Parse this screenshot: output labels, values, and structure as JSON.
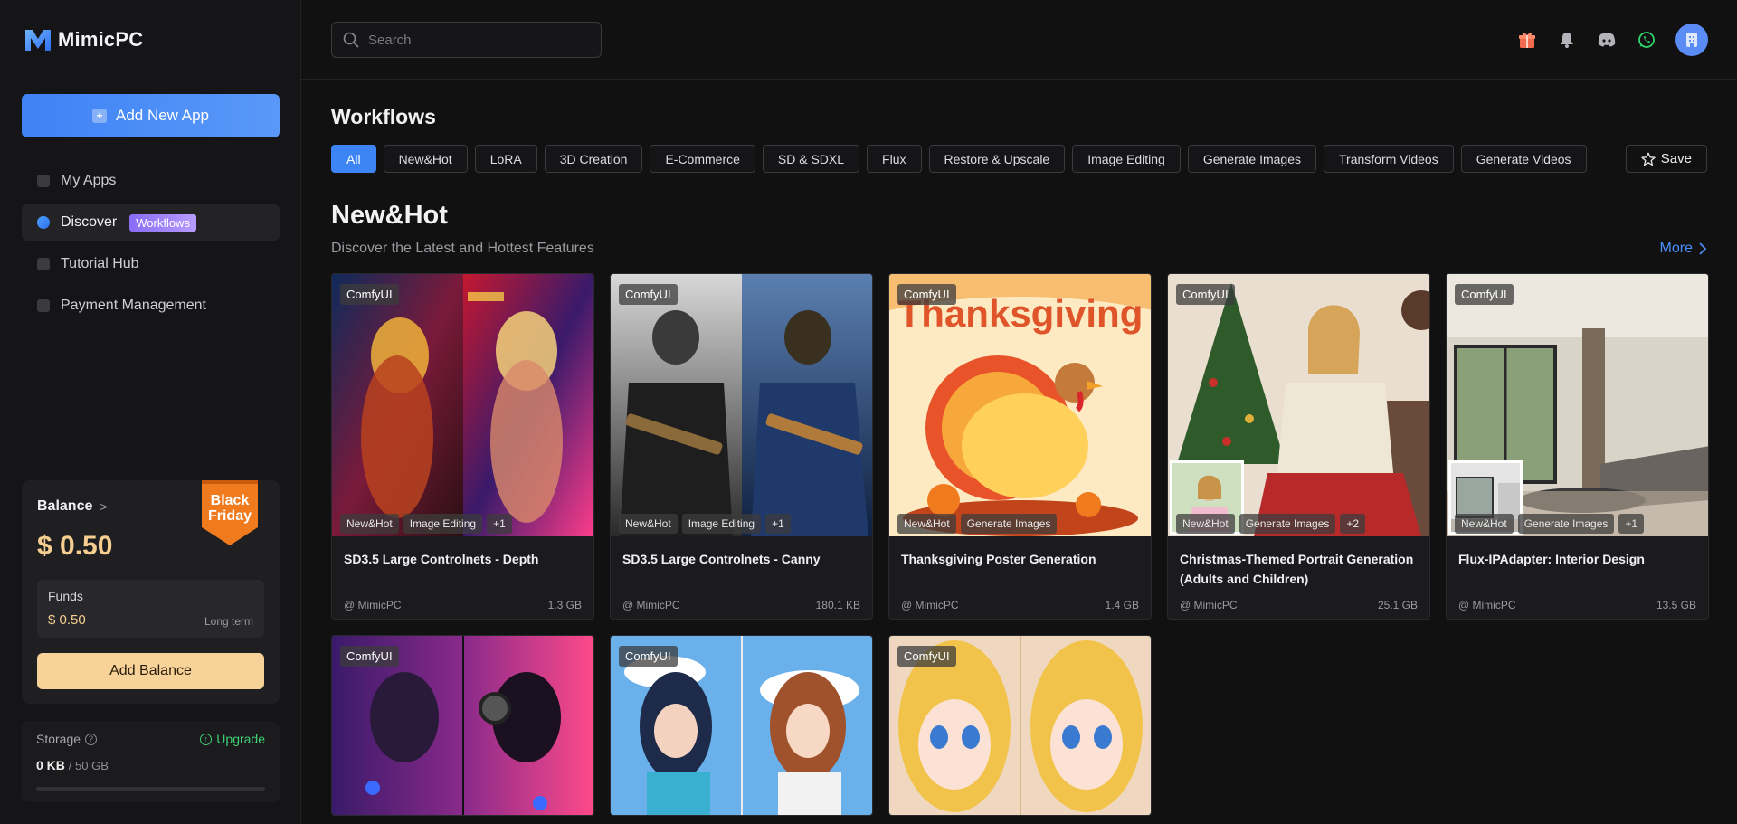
{
  "app": {
    "brand": "MimicPC"
  },
  "sidebar": {
    "add_app_label": "Add New App",
    "items": [
      {
        "label": "My Apps"
      },
      {
        "label": "Discover",
        "badge": "Workflows"
      },
      {
        "label": "Tutorial Hub"
      },
      {
        "label": "Payment Management"
      }
    ],
    "balance": {
      "title": "Balance",
      "amount": "$ 0.50",
      "promo_line1": "Black",
      "promo_line2": "Friday",
      "funds_label": "Funds",
      "funds_amount": "$ 0.50",
      "funds_term": "Long term",
      "add_balance_label": "Add Balance"
    },
    "storage": {
      "label": "Storage",
      "upgrade_label": "Upgrade",
      "used": "0 KB",
      "total": "/ 50 GB",
      "used_fraction": 0
    }
  },
  "topbar": {
    "search_placeholder": "Search",
    "icons": [
      "gift-icon",
      "bell-icon",
      "discord-icon",
      "whatsapp-icon",
      "avatar"
    ]
  },
  "workflows": {
    "title": "Workflows",
    "filters": [
      "All",
      "New&Hot",
      "LoRA",
      "3D Creation",
      "E-Commerce",
      "SD & SDXL",
      "Flux",
      "Restore & Upscale",
      "Image Editing",
      "Generate Images",
      "Transform Videos",
      "Generate Videos"
    ],
    "active_filter": "All",
    "save_label": "Save"
  },
  "section": {
    "title": "New&Hot",
    "subtitle": "Discover the Latest and Hottest Features",
    "more_label": "More"
  },
  "cards": [
    {
      "badge": "ComfyUI",
      "tags": [
        "New&Hot",
        "Image Editing",
        "+1"
      ],
      "title": "SD3.5 Large Controlnets - Depth",
      "author": "@ MimicPC",
      "size": "1.3 GB"
    },
    {
      "badge": "ComfyUI",
      "tags": [
        "New&Hot",
        "Image Editing",
        "+1"
      ],
      "title": "SD3.5 Large Controlnets - Canny",
      "author": "@ MimicPC",
      "size": "180.1 KB"
    },
    {
      "badge": "ComfyUI",
      "tags": [
        "New&Hot",
        "Generate Images"
      ],
      "title": "Thanksgiving Poster Generation",
      "author": "@ MimicPC",
      "size": "1.4 GB",
      "image_text": "Thanksgiving"
    },
    {
      "badge": "ComfyUI",
      "tags": [
        "New&Hot",
        "Generate Images",
        "+2"
      ],
      "title": "Christmas-Themed Portrait Generation (Adults and Children)",
      "author": "@ MimicPC",
      "size": "25.1 GB"
    },
    {
      "badge": "ComfyUI",
      "tags": [
        "New&Hot",
        "Generate Images",
        "+1"
      ],
      "title": "Flux-IPAdapter: Interior Design",
      "author": "@ MimicPC",
      "size": "13.5 GB"
    },
    {
      "badge": "ComfyUI"
    },
    {
      "badge": "ComfyUI"
    },
    {
      "badge": "ComfyUI"
    }
  ],
  "colors": {
    "accent": "#3d85f5",
    "balance": "#f6cf90",
    "upgrade": "#3fcf74",
    "background": "#111112"
  }
}
